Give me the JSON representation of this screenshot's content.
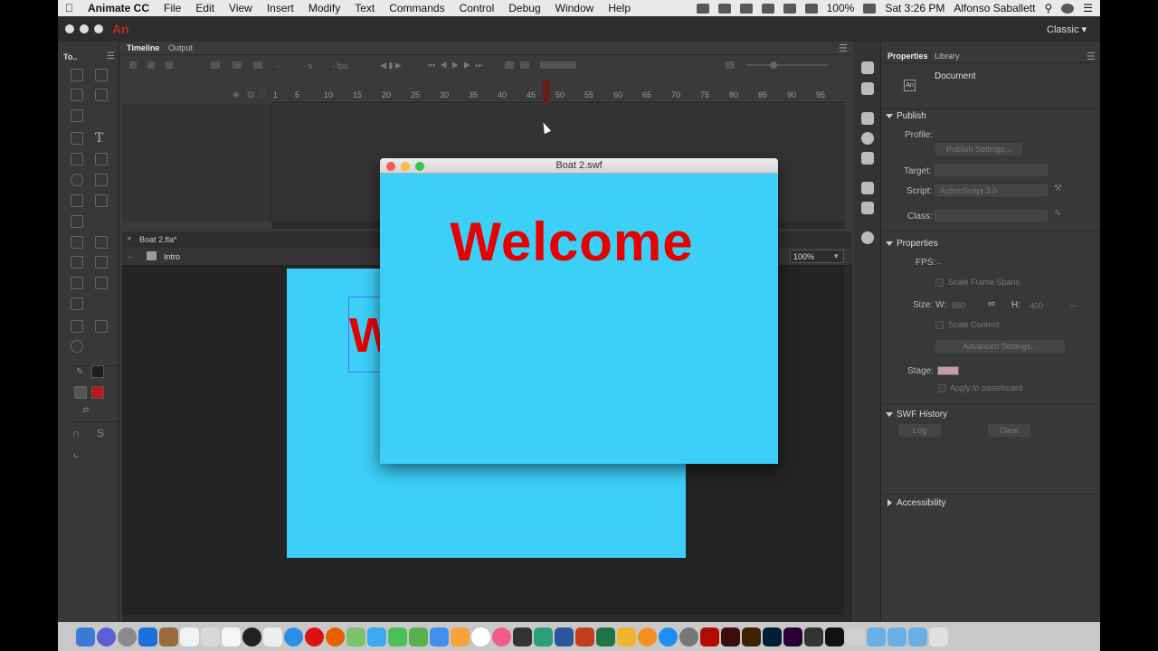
{
  "menubar": {
    "app_name": "Animate CC",
    "items": [
      "File",
      "Edit",
      "View",
      "Insert",
      "Modify",
      "Text",
      "Commands",
      "Control",
      "Debug",
      "Window",
      "Help"
    ],
    "battery": "100%",
    "clock": "Sat 3:26 PM",
    "user": "Alfonso Saballett"
  },
  "app": {
    "logo": "An",
    "workspace": "Classic"
  },
  "toolbox": {
    "title": "To.."
  },
  "timeline": {
    "tabs": [
      "Timeline",
      "Output"
    ],
    "fps_label": "fps",
    "ruler": [
      "1",
      "5",
      "10",
      "15",
      "20",
      "25",
      "30",
      "35",
      "40",
      "45",
      "50",
      "55",
      "60",
      "65",
      "70",
      "75",
      "80",
      "85",
      "90",
      "95"
    ]
  },
  "document": {
    "tab": "Boat 2.fla*",
    "scene": "Intro",
    "zoom": "100%",
    "stage_text": "W"
  },
  "swf_window": {
    "title": "Boat 2.swf",
    "text": "Welcome"
  },
  "properties": {
    "tabs": [
      "Properties",
      "Library"
    ],
    "doc_icon": "An",
    "doc_label": "Document",
    "publish_header": "Publish",
    "profile_label": "Profile:",
    "publish_settings_btn": "Publish Settings...",
    "target_label": "Target:",
    "script_label": "Script:",
    "script_value": "ActionScript 3.0",
    "class_label": "Class:",
    "properties_header": "Properties",
    "fps_label": "FPS:",
    "fps_value": "--",
    "scale_frame_spans": "Scale Frame Spans",
    "size_label": "Size:",
    "w_label": "W:",
    "w_value": "550",
    "h_label": "H:",
    "h_value": "400",
    "size_unit": "--",
    "scale_content": "Scale Content",
    "advanced_settings_btn": "Advanced Settings...",
    "stage_label": "Stage:",
    "apply_pasteboard": "Apply to pasteboard",
    "swf_history_header": "SWF History",
    "log_btn": "Log",
    "clear_btn": "Clear",
    "accessibility_header": "Accessibility"
  },
  "colors": {
    "stage": "#3ccff7",
    "welcome_text": "#e60000"
  }
}
